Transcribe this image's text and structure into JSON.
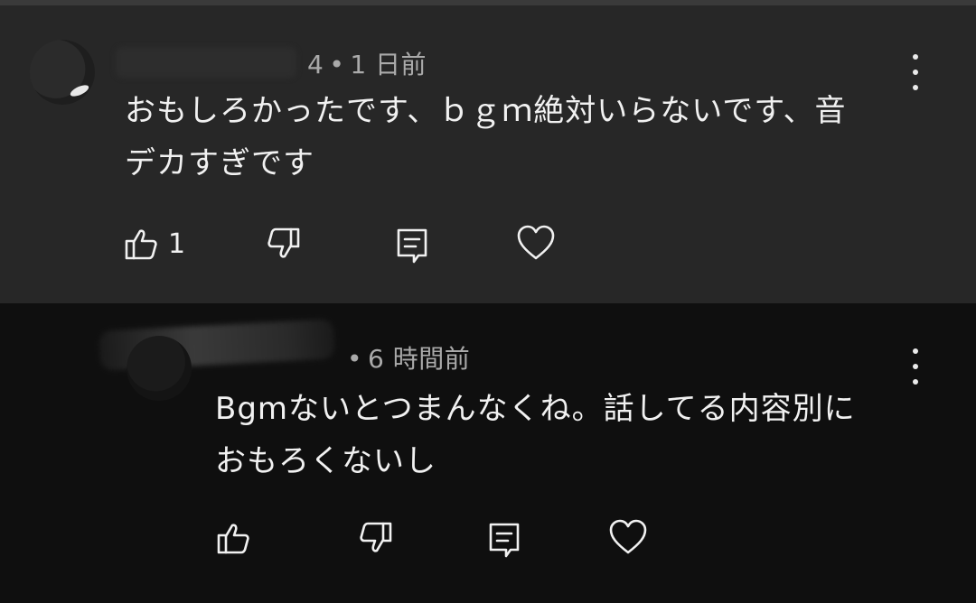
{
  "comments": [
    {
      "meta_suffix": "4",
      "time": "1 日前",
      "text_line1": "おもしろかったです、ｂｇｍ絶対いらないです、音",
      "text_line2": "デカすぎです",
      "like_count": "1"
    },
    {
      "time": "6 時間前",
      "text_line1": "Bgmないとつまんなくね。話してる内容別に",
      "text_line2": "おもろくないし"
    }
  ],
  "colors": {
    "first_bg": "#272727",
    "second_bg": "#0f0f0f",
    "meta": "#aaaaaa",
    "text": "#f1f1f1"
  },
  "icons": [
    "thumbs-up-icon",
    "thumbs-down-icon",
    "reply-icon",
    "heart-icon",
    "more-vert-icon"
  ]
}
